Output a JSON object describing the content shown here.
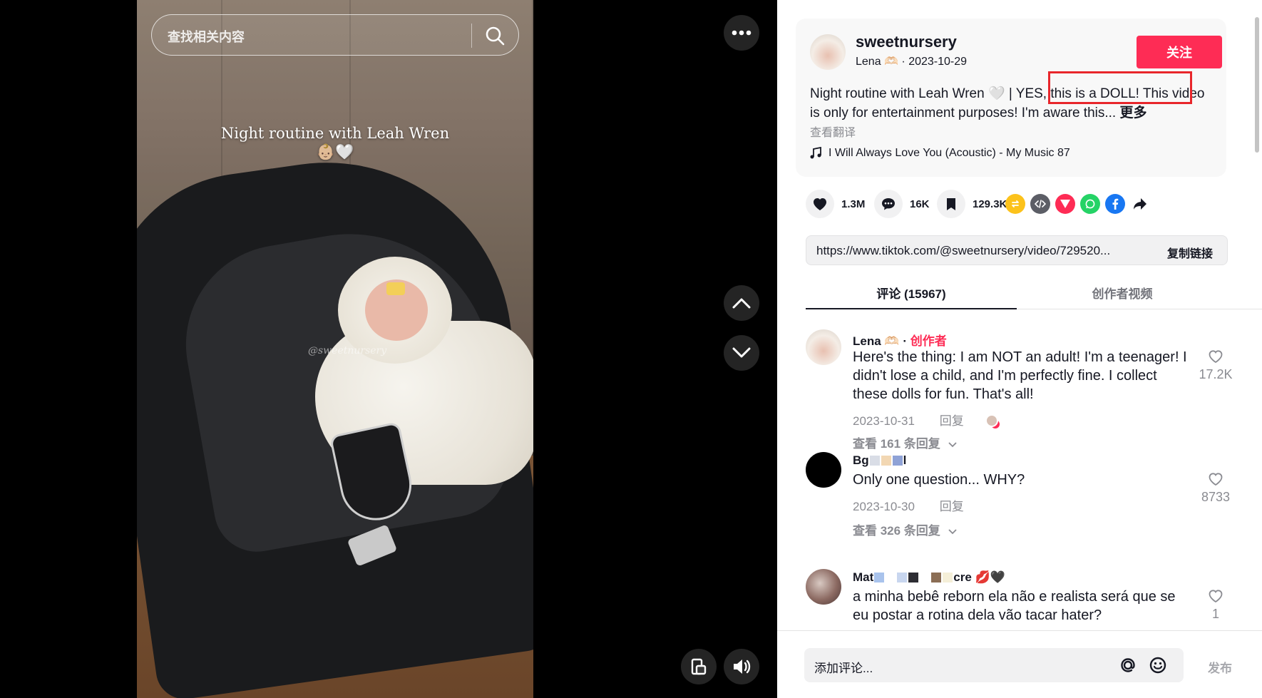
{
  "video": {
    "search_placeholder": "查找相关内容",
    "overlay_caption": "Night routine with Leah Wren 👶🏼🤍",
    "watermark": "@sweetnursery"
  },
  "author": {
    "username": "sweetnursery",
    "display_name": "Lena 🫶🏻",
    "date": "2023-10-29",
    "follow_label": "关注"
  },
  "description": {
    "part1": "Night routine with Leah Wren 🤍 | ",
    "highlighted": "YES, this is a DOLL!",
    "part2": " This video is only for entertainment purposes! I'm aware this...",
    "more_label": "更多",
    "translate_label": "查看翻译"
  },
  "music": {
    "icon": "music-note-icon",
    "title": "I Will Always Love You (Acoustic) - My Music 87"
  },
  "actions": {
    "likes": "1.3M",
    "comments": "16K",
    "saves": "129.3K"
  },
  "share": {
    "url": "https://www.tiktok.com/@sweetnursery/video/729520...",
    "copy_label": "复制链接"
  },
  "tabs": {
    "comments": "评论 (15967)",
    "creator_videos": "创作者视频"
  },
  "comments": [
    {
      "user": "Lena 🫶🏻",
      "creator_badge": "创作者",
      "text": "Here's the thing: I am NOT an adult! I'm a teenager! I didn't lose a child, and I'm perfectly fine. I collect these dolls for fun. That's all!",
      "date": "2023-10-31",
      "reply_label": "回复",
      "view_replies": "查看 161 条回复",
      "likes": "17.2K"
    },
    {
      "user": "Bg",
      "user_suffix": "l",
      "text": "Only one question... WHY?",
      "date": "2023-10-30",
      "reply_label": "回复",
      "view_replies": "查看 326 条回复",
      "likes": "8733"
    },
    {
      "user": "Mat",
      "user_suffix": "cre 💋🖤",
      "text": "a minha bebê reborn ela não e realista será que se eu postar a rotina dela vão tacar hater?",
      "likes": "1"
    }
  ],
  "bottom": {
    "input_placeholder": "添加评论...",
    "post_label": "发布"
  }
}
